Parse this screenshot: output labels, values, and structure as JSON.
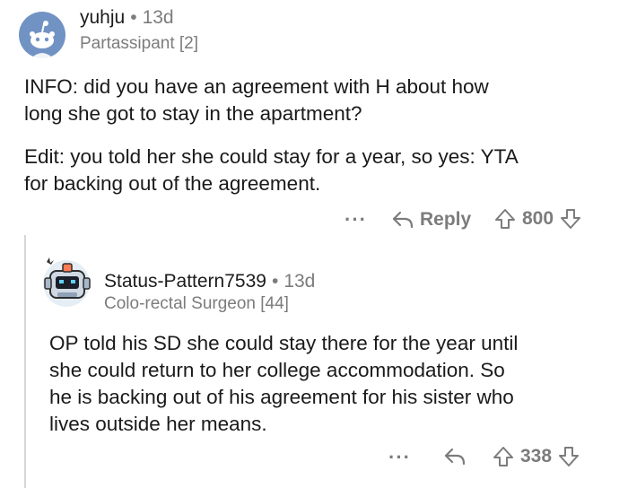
{
  "comment1": {
    "username": "yuhju",
    "separator": "•",
    "age": "13d",
    "flair": "Partassipant [2]",
    "paragraph1_line1": "INFO: did you have an agreement with H about how",
    "paragraph1_line2": "long she got to stay in the apartment?",
    "paragraph2_line1": "Edit: you told her she could stay for a year, so yes: YTA",
    "paragraph2_line2": "for backing out of the agreement.",
    "more_label": "···",
    "reply_label": "Reply",
    "score": "800",
    "avatar_icon": "reddit-snoo-avatar-icon"
  },
  "comment2": {
    "username": "Status-Pattern7539",
    "separator": "•",
    "age": "13d",
    "flair": "Colo-rectal Surgeon [44]",
    "line1": "OP told his SD she could stay there for the year until",
    "line2": "she could return to her college accommodation. So",
    "line3": "he is backing out of his agreement for his sister who",
    "line4": "lives outside her means.",
    "more_label": "···",
    "score": "338",
    "avatar_icon": "robot-avatar-icon"
  },
  "colors": {
    "meta_gray": "#7c7c7c",
    "avatar_blue": "#7193c4",
    "thread_line": "#d6d6d6"
  }
}
